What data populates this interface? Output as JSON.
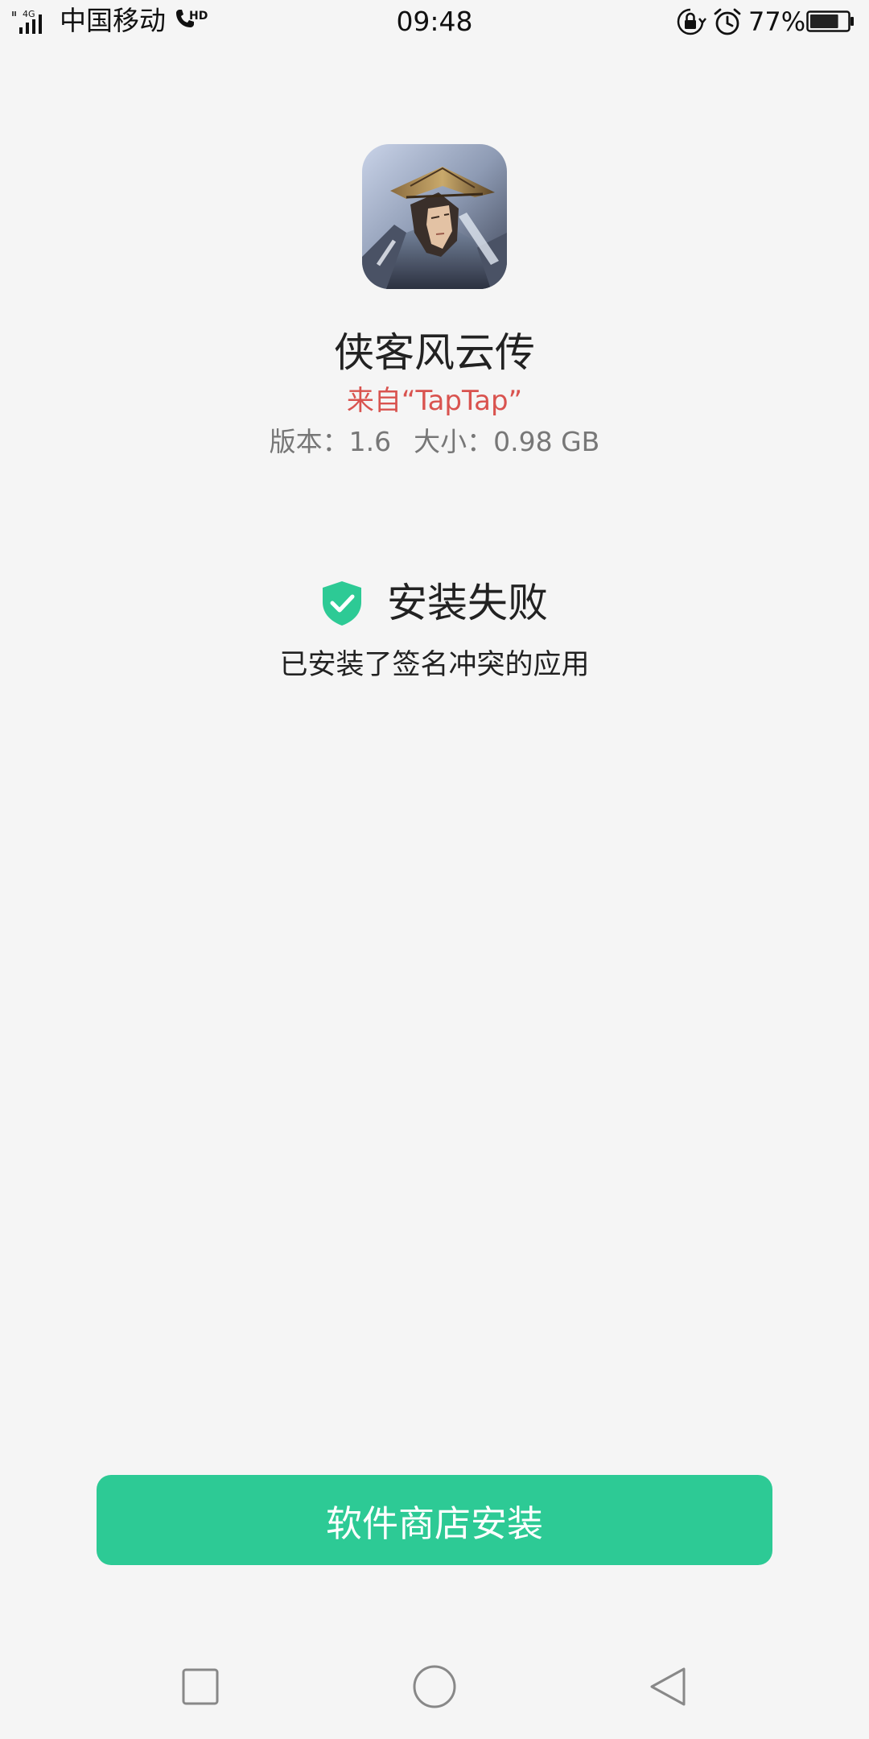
{
  "status_bar": {
    "network": "4G",
    "carrier": "中国移动",
    "call_badge": "HD",
    "time": "09:48",
    "battery_percent": "77%",
    "battery_level": 0.77,
    "icons": [
      "signal-icon",
      "hd-call-icon",
      "rotation-lock-icon",
      "alarm-icon",
      "battery-icon"
    ]
  },
  "app": {
    "icon": "app-icon-image",
    "name": "侠客风云传",
    "source": "来自“TapTap”",
    "version": "版本：1.6",
    "size": "大小：0.98 GB"
  },
  "result": {
    "icon": "shield-check-icon",
    "title": "安装失败",
    "description": "已安装了签名冲突的应用"
  },
  "actions": {
    "store_install_label": "软件商店安装"
  },
  "nav_bar": {
    "icons": [
      "recents-icon",
      "home-icon",
      "back-icon"
    ]
  },
  "colors": {
    "background": "#f5f5f5",
    "accent_green": "#2dca95",
    "source_red": "#d9534f",
    "text_primary": "#222222",
    "text_secondary": "#777777"
  }
}
